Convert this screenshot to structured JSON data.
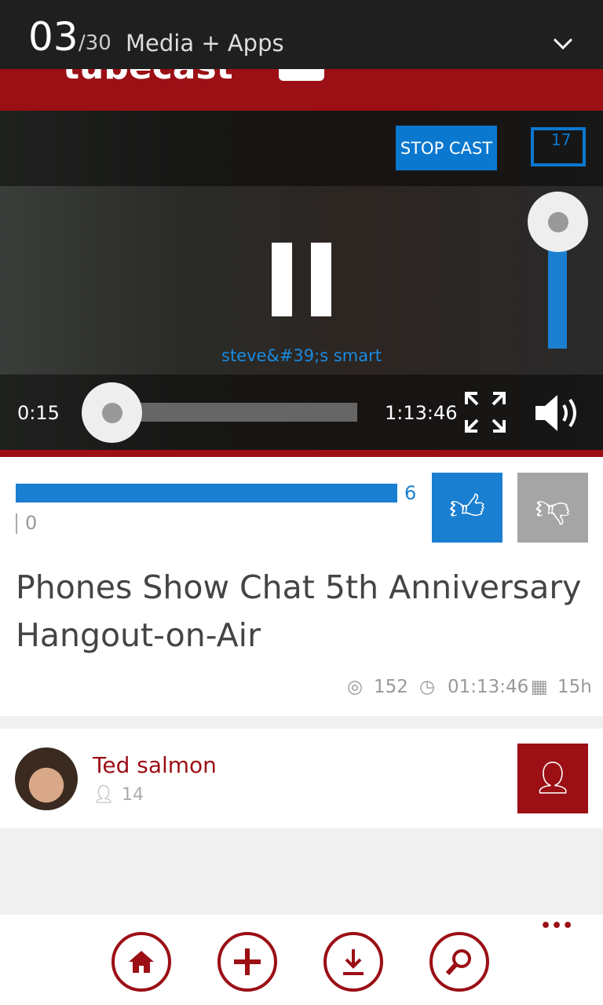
{
  "status": {
    "current": "03",
    "total": "/30",
    "title": "Media + Apps"
  },
  "header": {
    "logo": "tubecast"
  },
  "player": {
    "stop_cast": "STOP CAST",
    "cast_count": "17",
    "caption": "steve&#39;s smart",
    "elapsed": "0:15",
    "duration": "1:13:46",
    "progress": 0.005,
    "volume": 1.0
  },
  "rating": {
    "likes": "6",
    "dislikes": "0",
    "like_fraction": 1.0,
    "accent": "#1a7fd0"
  },
  "video": {
    "title": "Phones Show Chat 5th Anniversary Hangout-on-Air",
    "views": "152",
    "length": "01:13:46",
    "age": "15h"
  },
  "channel": {
    "name": "Ted salmon",
    "subscribers": "14"
  },
  "appbar": {
    "more": "•••"
  },
  "colors": {
    "brand": "#9b0f15",
    "blue": "#0b78d0"
  }
}
